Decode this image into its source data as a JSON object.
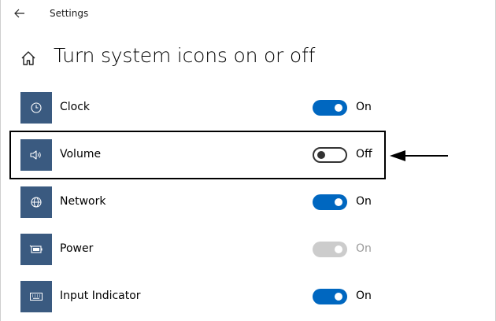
{
  "window": {
    "title": "Settings"
  },
  "page": {
    "title": "Turn system icons on or off"
  },
  "items": [
    {
      "label": "Clock",
      "state": "On",
      "toggle": "on",
      "icon": "clock-icon"
    },
    {
      "label": "Volume",
      "state": "Off",
      "toggle": "off",
      "icon": "volume-icon"
    },
    {
      "label": "Network",
      "state": "On",
      "toggle": "on",
      "icon": "globe-icon"
    },
    {
      "label": "Power",
      "state": "On",
      "toggle": "disabled",
      "icon": "battery-icon"
    },
    {
      "label": "Input Indicator",
      "state": "On",
      "toggle": "on",
      "icon": "keyboard-icon"
    }
  ],
  "colors": {
    "accent": "#0067c0",
    "icon_tile": "#3a5a80",
    "disabled": "#cccccc"
  }
}
